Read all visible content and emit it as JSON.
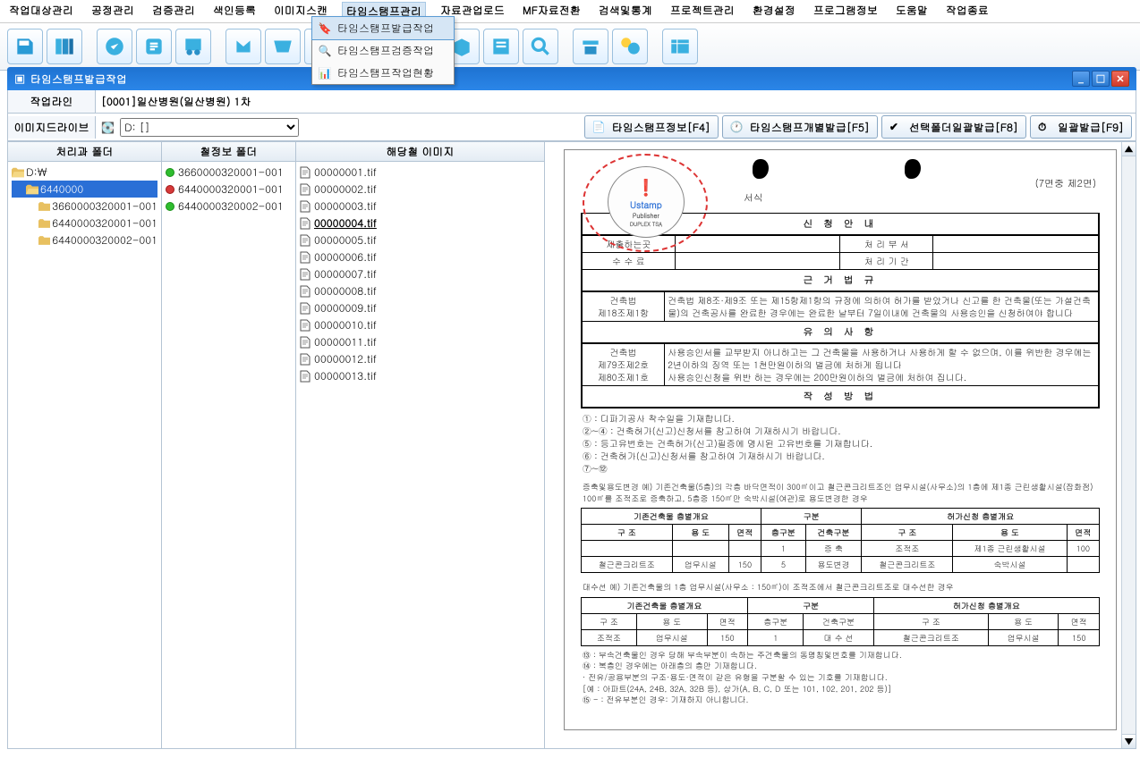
{
  "menu": {
    "items": [
      "작업대상관리",
      "공정관리",
      "검증관리",
      "색인등록",
      "이미지스캔",
      "타임스탬프관리",
      "자료관업로드",
      "MF자료전환",
      "검색및통계",
      "프로젝트관리",
      "환경설정",
      "프로그램정보",
      "도움말",
      "작업종료"
    ],
    "active_index": 5
  },
  "dropdown": {
    "items": [
      "타임스탬프발급작업",
      "타임스탬프검증작업",
      "타임스탬프작업현황"
    ],
    "selected_index": 0
  },
  "window": {
    "title": "타임스탬프발급작업"
  },
  "form": {
    "workline_label": "작업라인",
    "workline_value": "[0001]일산병원(일산병원) 1차",
    "drive_label": "이미지드라이브",
    "drive_value": "D: []"
  },
  "tabs": [
    {
      "label": "타임스탬프정보[F4]"
    },
    {
      "label": "타임스탬프개별발급[F5]"
    },
    {
      "label": "선택폴더일괄발급[F8]"
    },
    {
      "label": "일괄발급[F9]"
    }
  ],
  "headers": {
    "col1": "처리과 폴더",
    "col2": "철정보 폴더",
    "col3": "해당철 이미지"
  },
  "tree": [
    {
      "depth": 0,
      "label": "D:\\",
      "type": "folder-open"
    },
    {
      "depth": 1,
      "label": "6440000",
      "type": "folder-open",
      "selected": true
    },
    {
      "depth": 2,
      "label": "3660000320001-001",
      "type": "folder"
    },
    {
      "depth": 2,
      "label": "6440000320001-001",
      "type": "folder"
    },
    {
      "depth": 2,
      "label": "6440000320002-001",
      "type": "folder"
    }
  ],
  "folders": [
    {
      "dot": "green",
      "label": "3660000320001-001"
    },
    {
      "dot": "red",
      "label": "6440000320001-001"
    },
    {
      "dot": "green",
      "label": "6440000320002-001"
    }
  ],
  "images": [
    "00000001.tif",
    "00000002.tif",
    "00000003.tif",
    "00000004.tif",
    "00000005.tif",
    "00000006.tif",
    "00000007.tif",
    "00000008.tif",
    "00000009.tif",
    "00000010.tif",
    "00000011.tif",
    "00000012.tif",
    "00000013.tif"
  ],
  "image_selected_index": 3,
  "document": {
    "stamp_brand": "Ustamp",
    "stamp_sub": "Publisher",
    "stamp_sub2": "DUPLEX TSA",
    "page_indicator": "(7면중 제2면)",
    "seosik_label": "서식",
    "title": "신 청 안 내",
    "submit_label": "제출하는곳",
    "dept_label": "처 리 부 서",
    "fee_label": "수 수 료",
    "period_label": "처 리 기 간",
    "law_header": "근 거 법 규",
    "law1_left": "건축법\n제18조제1항",
    "law1_right": "건축법 제8조·제9조 또는 제15항제1항의 규정에 의하여 허가를 받았거나 신고를 한 건축물(또는 가설건축물)의 건축공사를 완료한 경우에는 완료한 날부터 7일이내에 건축물의 사용승인을 신청하여야 합니다",
    "notice_header": "유 의 사 항",
    "notice_left": "건축법\n제79조제2호\n제80조제1호",
    "notice_right": "사용승인서를 교부받지 아니하고는 그 건축물을 사용하거나 사용하게 할 수 없으며, 이를 위반한 경우에는 2년이하의 징역 또는 1천만원이하의 벌금에 처하게 됩니다\n사용승인신청을 위반 하는 경우에는 200만원이하의 벌금에 처하여 집니다.",
    "method_header": "작 성 방 법",
    "method_lines": [
      "① : 디파기공사 착수일을 기재합니다.",
      "②~④ : 건축허가(신고)신청서를 참고하여 기재하시기 바랍니다.",
      "⑤ : 등고유번호는 건축허가(신고)필증에 명시된 고유번호를 기재합니다.",
      "⑥ : 건축허가(신고)신청서를 참고하여 기재하시기 바랍니다.",
      "⑦~⑫"
    ],
    "example_header": "증축및용도변경 예) 기존건축물(5층)의 각층 바닥면적이 300㎡이고 철근콘크리트조인 업무시설(사무소)의 1층에 제1종 근린생활시설(잡화점) 100㎡를 조적조로 증축하고, 5층중 150㎡만 숙박시설(여관)로 용도변경한 경우",
    "table1_hdr1": "기존건축물 층별개요",
    "table1_hdr2": "구분",
    "table1_hdr3": "허가신청 층별개요",
    "table1_cols": [
      "구 조",
      "용 도",
      "면적",
      "층구분",
      "건축구분",
      "구 조",
      "용 도",
      "면적"
    ],
    "table1_rows": [
      [
        "",
        "",
        "",
        "1",
        "증 축",
        "조적조",
        "제1종 근린생활시설",
        "100"
      ],
      [
        "철근콘크리트조",
        "업무시설",
        "150",
        "5",
        "용도변경",
        "철근콘크리트조",
        "숙박시설",
        ""
      ]
    ],
    "example2_header": "대수선 예) 기존건축물의 1층 업무시설(사무소 : 150㎡)이 조적조에서 철근콘크리트조로 대수선한 경우",
    "table2_rows": [
      [
        "구 조",
        "용 도",
        "면적",
        "층구분",
        "건축구분",
        "구 조",
        "용 도",
        "면적"
      ],
      [
        "조적조",
        "업무시설",
        "150",
        "1",
        "대 수 선",
        "철근콘크리트조",
        "업무시설",
        "150"
      ]
    ],
    "notes": [
      "⑬ : 부속건축물인 경우 당해 부속부분이 속하는 주건축물의 동명칭및번호를 기재합니다.",
      "⑭ : 복층인 경우에는 아래층의 층만 기재합니다.",
      "· 전유/공용부분의 구조·용도·면적이 같은 유형을 구분할 수 있는 기호를 기재합니다.",
      "  [예 : 아파트(24A, 24B, 32A, 32B 등), 상가(A, B, C, D 또는 101, 102, 201, 202 등)]",
      "⑮ -  : 전유부분인 경우: 기재하지 아니합니다."
    ]
  }
}
